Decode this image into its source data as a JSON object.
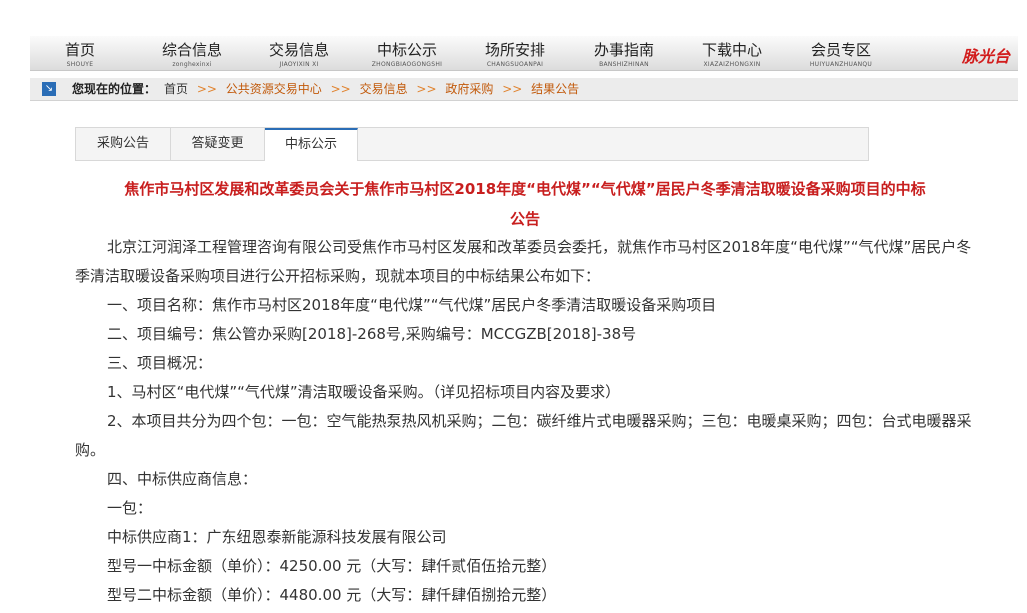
{
  "nav": {
    "items": [
      {
        "zh": "首页",
        "py": "SHOUYE"
      },
      {
        "zh": "综合信息",
        "py": "zonghexinxi"
      },
      {
        "zh": "交易信息",
        "py": "JIAOYIXIN XI"
      },
      {
        "zh": "中标公示",
        "py": "ZHONGBIAOGONGSHI"
      },
      {
        "zh": "场所安排",
        "py": "CHANGSUOANPAI"
      },
      {
        "zh": "办事指南",
        "py": "BANSHIZHINAN"
      },
      {
        "zh": "下载中心",
        "py": "XIAZAIZHONGXIN"
      },
      {
        "zh": "会员专区",
        "py": "HUIYUANZHUANQU"
      }
    ],
    "logo": "脉光台"
  },
  "breadcrumb": {
    "label": "您现在的位置：",
    "home": "首页",
    "sep": ">>",
    "links": [
      "公共资源交易中心",
      "交易信息",
      "政府采购",
      "结果公告"
    ]
  },
  "tabs": [
    "采购公告",
    "答疑变更",
    "中标公示"
  ],
  "article": {
    "title_line1": "焦作市马村区发展和改革委员会关于焦作市马村区2018年度“电代煤”“气代煤”居民户冬季清洁取暖设备采购项目的中标",
    "title_line2": "公告",
    "intro": "北京江河润泽工程管理咨询有限公司受焦作市马村区发展和改革委员会委托，就焦作市马村区2018年度“电代煤”“气代煤”居民户冬季清洁取暖设备采购项目进行公开招标采购，现就本项目的中标结果公布如下：",
    "p1": "一、项目名称：焦作市马村区2018年度“电代煤”“气代煤”居民户冬季清洁取暖设备采购项目",
    "p2": "二、项目编号：焦公管办采购[2018]-268号,采购编号：MCCGZB[2018]-38号",
    "p3": "三、项目概况：",
    "p4": "1、马村区“电代煤”“气代煤”清洁取暖设备采购。（详见招标项目内容及要求）",
    "p5": "2、本项目共分为四个包：一包：空气能热泵热风机采购；二包：碳纤维片式电暖器采购；三包：电暖桌采购；四包：台式电暖器采购。",
    "p6": "四、中标供应商信息：",
    "p7": "一包：",
    "p8": "中标供应商1：广东纽恩泰新能源科技发展有限公司",
    "p9": "型号一中标金额（单价）：4250.00 元（大写：肆仟贰佰伍拾元整）",
    "p10": "型号二中标金额（单价）：4480.00 元（大写：肆仟肆佰捌拾元整）"
  },
  "colors": {
    "title_red": "#c81e1e",
    "link_orange": "#c25a0b",
    "accent_blue": "#2a6db6"
  }
}
